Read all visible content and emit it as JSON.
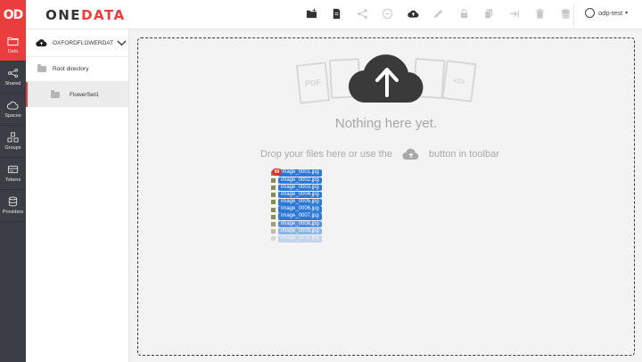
{
  "header": {
    "logo_mark": "OD",
    "brand_part1": "ONE",
    "brand_part2": "DATA",
    "user_name": "odp-test",
    "toolbar_icons": [
      "new-directory-icon",
      "new-file-icon",
      "share-icon",
      "metadata-icon",
      "upload-icon",
      "rename-icon",
      "permissions-icon",
      "copy-icon",
      "move-icon",
      "delete-icon",
      "distribution-icon"
    ]
  },
  "nav": {
    "items": [
      {
        "label": "Data",
        "icon": "data-icon",
        "active": true
      },
      {
        "label": "Shared",
        "icon": "share-icon",
        "active": false
      },
      {
        "label": "Spaces",
        "icon": "cloud-icon",
        "active": false
      },
      {
        "label": "Groups",
        "icon": "groups-icon",
        "active": false
      },
      {
        "label": "Tokens",
        "icon": "tokens-icon",
        "active": false
      },
      {
        "label": "Providers",
        "icon": "providers-icon",
        "active": false
      }
    ]
  },
  "sidebar": {
    "space_name": "OXFORDFLOWERDAT...",
    "root_label": "Root directory",
    "child_label": "FlowerSet1"
  },
  "main": {
    "empty_title": "Nothing here yet.",
    "hint_before": "Drop your files here or use the",
    "hint_after": "button in toolbar",
    "ghost_labels": [
      "PDF",
      "</>"
    ]
  },
  "drag": {
    "count": "99",
    "files": [
      "image_0001.jpg",
      "image_0002.jpg",
      "image_0003.jpg",
      "image_0004.jpg",
      "image_0005.jpg",
      "image_0006.jpg",
      "image_0007.jpg",
      "image_0008.jpg",
      "image_0009.jpg",
      "image_0010.jpg"
    ]
  },
  "colors": {
    "accent": "#ea3e3e",
    "nav_bg": "#3b3e45",
    "selection_blue": "#2b78d6"
  }
}
